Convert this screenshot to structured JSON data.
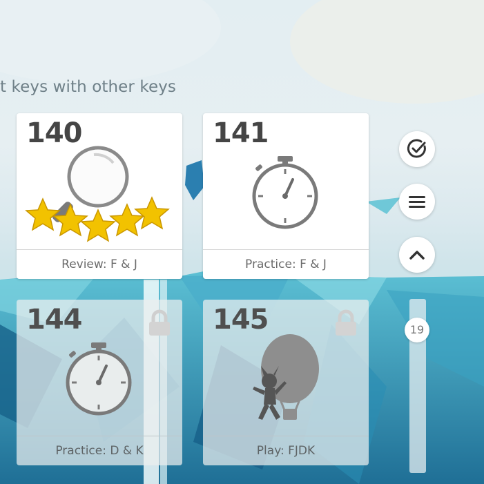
{
  "lesson_heading": "t keys with other keys",
  "cards": [
    {
      "number": "140",
      "label": "Review: F & J",
      "icon": "magnifier-stars-icon",
      "stars": 5,
      "locked": false
    },
    {
      "number": "141",
      "label": "Practice: F & J",
      "icon": "stopwatch-icon",
      "locked": false
    },
    {
      "number": "144",
      "label": "Practice: D & K",
      "icon": "stopwatch-icon",
      "locked": true
    },
    {
      "number": "145",
      "label": "Play: FJDK",
      "icon": "balloon-character-icon",
      "locked": true
    }
  ],
  "side_controls": {
    "progress_icon": "check-circle-icon",
    "menu_icon": "hamburger-menu-icon",
    "scroll_up_icon": "chevron-up-icon",
    "scroll_position": "19"
  },
  "colors": {
    "card_bg": "#ffffff",
    "number_text": "#454545",
    "star_gold": "#f2c200",
    "ice_blue": "#2e8fb0"
  }
}
